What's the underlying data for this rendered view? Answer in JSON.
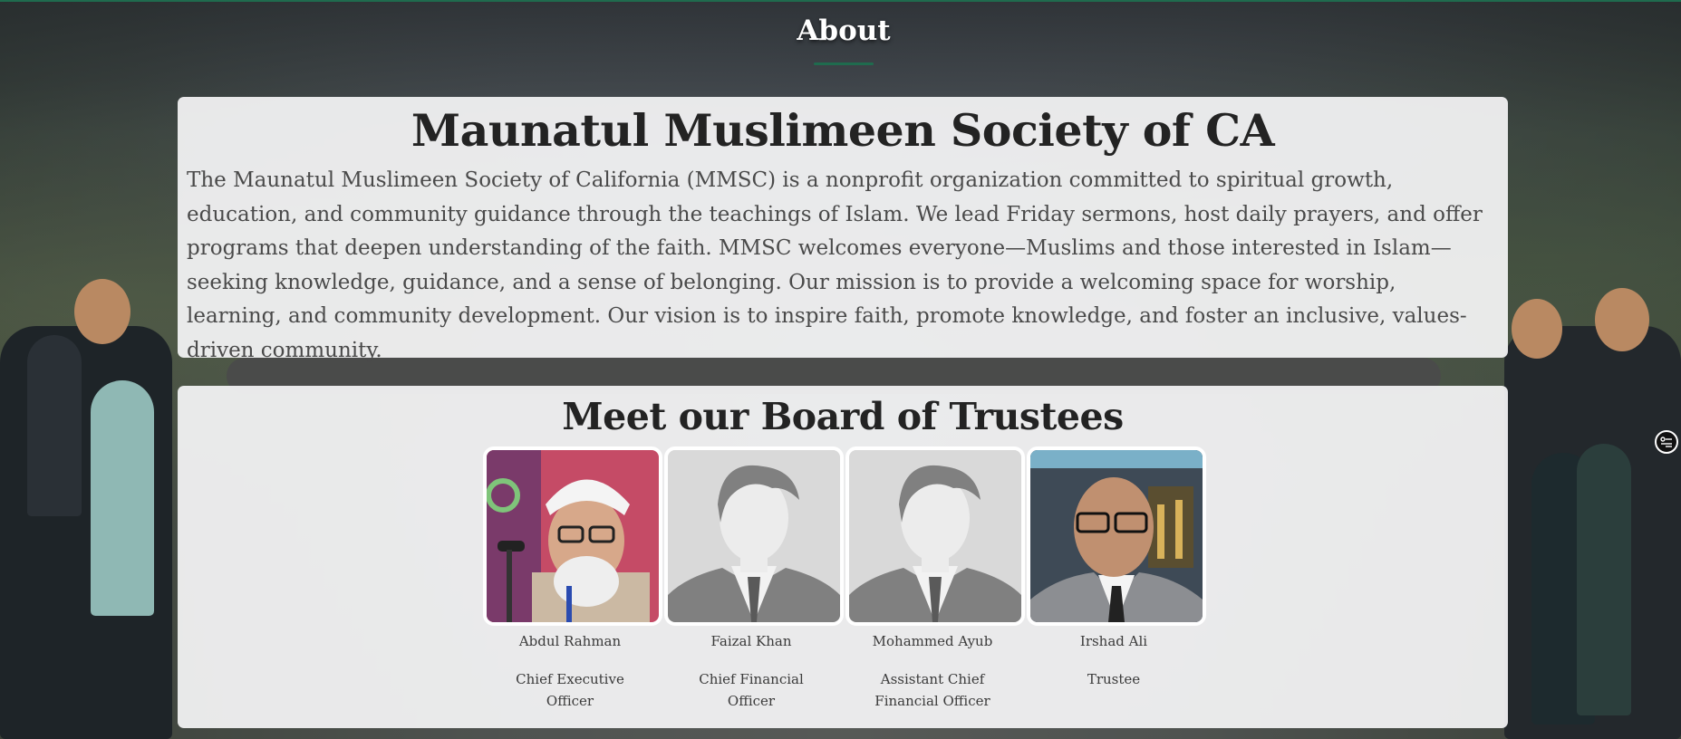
{
  "section": {
    "title": "About"
  },
  "about": {
    "org_name": "Maunatul Muslimeen Society of CA",
    "description": "The Maunatul Muslimeen Society of California (MMSC) is a nonprofit organization committed to spiritual growth, education, and community guidance through the teachings of Islam. We lead Friday sermons, host daily prayers, and offer programs that deepen understanding of the faith. MMSC welcomes everyone—Muslims and those interested in Islam—seeking knowledge, guidance, and a sense of belonging. Our mission is to provide a welcoming space for worship, learning, and community development. Our vision is to inspire faith, promote knowledge, and foster an inclusive, values-driven community."
  },
  "board": {
    "title": "Meet our Board of Trustees",
    "trustees": [
      {
        "name": "Abdul Rahman",
        "role": "Chief Executive Officer",
        "photo": "portrait-photo"
      },
      {
        "name": "Faizal Khan",
        "role": "Chief Financial Officer",
        "photo": "placeholder-avatar"
      },
      {
        "name": "Mohammed Ayub",
        "role": "Assistant Chief Financial Officer",
        "photo": "placeholder-avatar"
      },
      {
        "name": "Irshad Ali",
        "role": "Trustee",
        "photo": "portrait-photo"
      }
    ]
  },
  "floating": {
    "icon": "settings-sliders-icon"
  },
  "colors": {
    "accent": "#1f6b4e",
    "card_bg": "#f5f5f6",
    "text_dark": "#232323"
  }
}
